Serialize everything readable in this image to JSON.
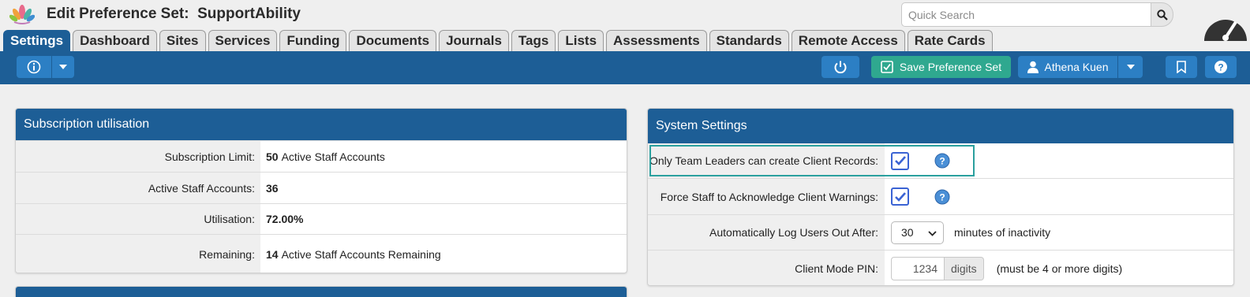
{
  "header": {
    "title": "Edit Preference Set:  SupportAbility",
    "search_placeholder": "Quick Search"
  },
  "tabs": [
    {
      "label": "Settings",
      "active": true
    },
    {
      "label": "Dashboard"
    },
    {
      "label": "Sites"
    },
    {
      "label": "Services"
    },
    {
      "label": "Funding"
    },
    {
      "label": "Documents"
    },
    {
      "label": "Journals"
    },
    {
      "label": "Tags"
    },
    {
      "label": "Lists"
    },
    {
      "label": "Assessments"
    },
    {
      "label": "Standards"
    },
    {
      "label": "Remote Access"
    },
    {
      "label": "Rate Cards"
    }
  ],
  "toolbar": {
    "save_label": "Save Preference Set",
    "user_name": "Athena Kuen"
  },
  "subscription": {
    "title": "Subscription utilisation",
    "rows": [
      {
        "label": "Subscription Limit:",
        "value_bold": "50",
        "value_text": "Active Staff Accounts"
      },
      {
        "label": "Active Staff Accounts:",
        "value_bold": "36",
        "value_text": ""
      },
      {
        "label": "Utilisation:",
        "value_bold": "72.00%",
        "value_text": ""
      },
      {
        "label": "Remaining:",
        "value_bold": "14",
        "value_text": "Active Staff Accounts Remaining"
      }
    ]
  },
  "system": {
    "title": "System Settings",
    "team_leaders_label": "Only Team Leaders can create Client Records:",
    "force_ack_label": "Force Staff to Acknowledge Client Warnings:",
    "logout_label": "Automatically Log Users Out After:",
    "logout_value": "30",
    "logout_suffix": "minutes of inactivity",
    "pin_label": "Client Mode PIN:",
    "pin_value": "1234",
    "pin_addon": "digits",
    "pin_hint": "(must be 4 or more digits)"
  },
  "colors": {
    "primary": "#1d5e96",
    "button": "#2c7fc4",
    "save": "#2fa88f",
    "highlight": "#2aa09e",
    "checkbox": "#3a63d4"
  }
}
